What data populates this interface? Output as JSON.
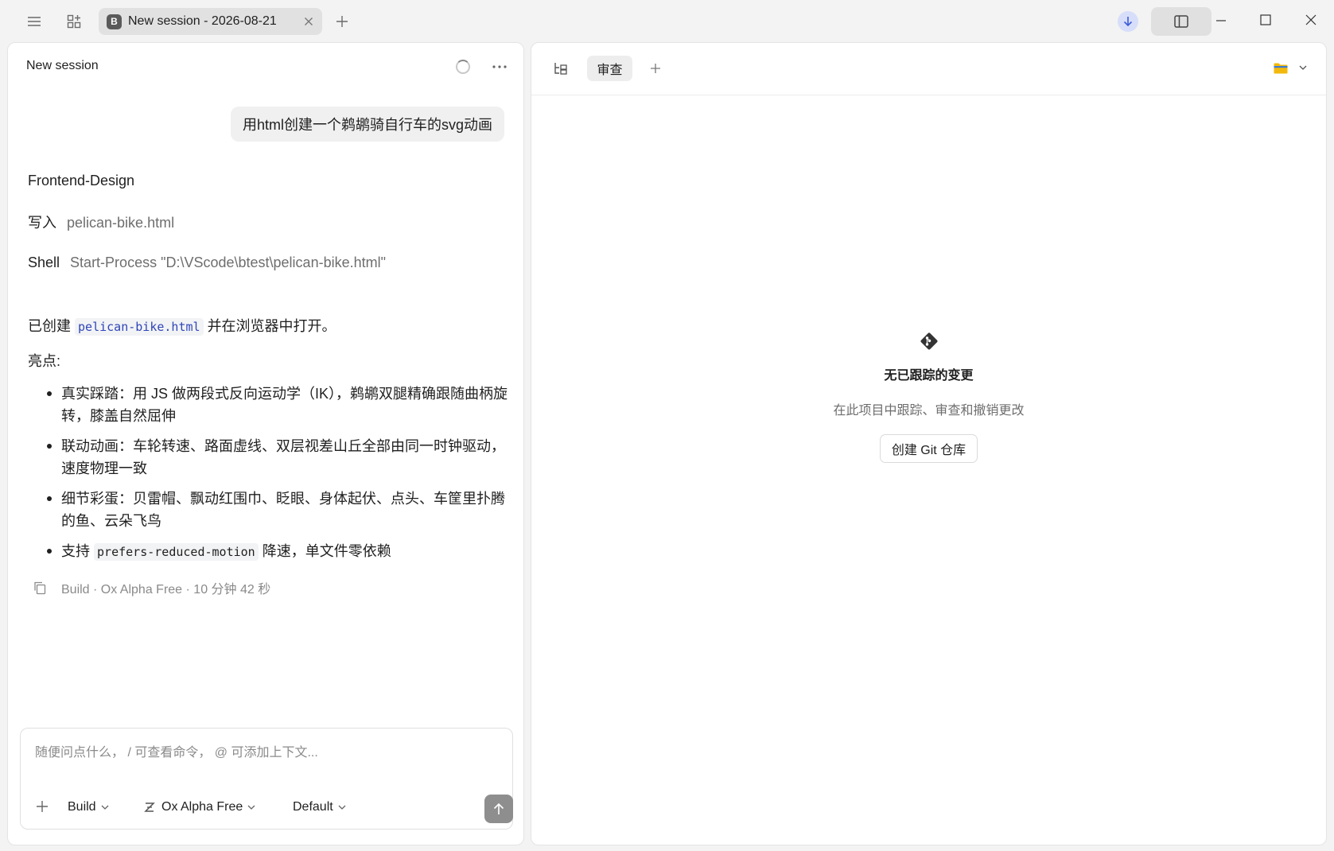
{
  "titlebar": {
    "tab_badge": "B",
    "tab_title": "New session - 2026-08-21",
    "icons": [
      "menu-icon",
      "layout-grid-icon",
      "close-icon",
      "plus-icon",
      "download-icon",
      "sidebar-toggle-icon",
      "minimize-icon",
      "maximize-icon",
      "window-close-icon"
    ]
  },
  "session": {
    "title": "New session",
    "user_message": "用html创建一个鹈鹕骑自行车的svg动画",
    "skill": "Frontend-Design",
    "write_label": "写入",
    "write_file": "pelican-bike.html",
    "shell_label": "Shell",
    "shell_command": "Start-Process \"D:\\VScode\\btest\\pelican-bike.html\"",
    "created_prefix": "已创建",
    "created_file": "pelican-bike.html",
    "created_suffix": "并在浏览器中打开。",
    "highlights_label": "亮点:",
    "bullets": [
      {
        "text": "真实踩踏：用 JS 做两段式反向运动学（IK），鹈鹕双腿精确跟随曲柄旋转，膝盖自然屈伸"
      },
      {
        "text": "联动动画：车轮转速、路面虚线、双层视差山丘全部由同一时钟驱动，速度物理一致"
      },
      {
        "text": "细节彩蛋：贝雷帽、飘动红围巾、眨眼、身体起伏、点头、车筐里扑腾的鱼、云朵飞鸟"
      },
      {
        "prefix": "支持",
        "code": "prefers-reduced-motion",
        "suffix": "降速，单文件零依赖"
      }
    ],
    "meta": "Build · Ox Alpha Free · 10 分钟 42 秒"
  },
  "composer": {
    "placeholder": "随便问点什么， / 可查看命令， @ 可添加上下文...",
    "value": "",
    "agent": "Build",
    "model": "Ox Alpha Free",
    "variant": "Default"
  },
  "review": {
    "tab_label": "审查",
    "empty_title": "无已跟踪的变更",
    "empty_subtitle": "在此项目中跟踪、审查和撤销更改",
    "create_git_button": "创建 Git 仓库"
  },
  "colors": {
    "accent": "#3d5bd9",
    "code_text": "#2f45b8",
    "send_button": "#8e8e8e",
    "folder": "#f2b90c"
  }
}
